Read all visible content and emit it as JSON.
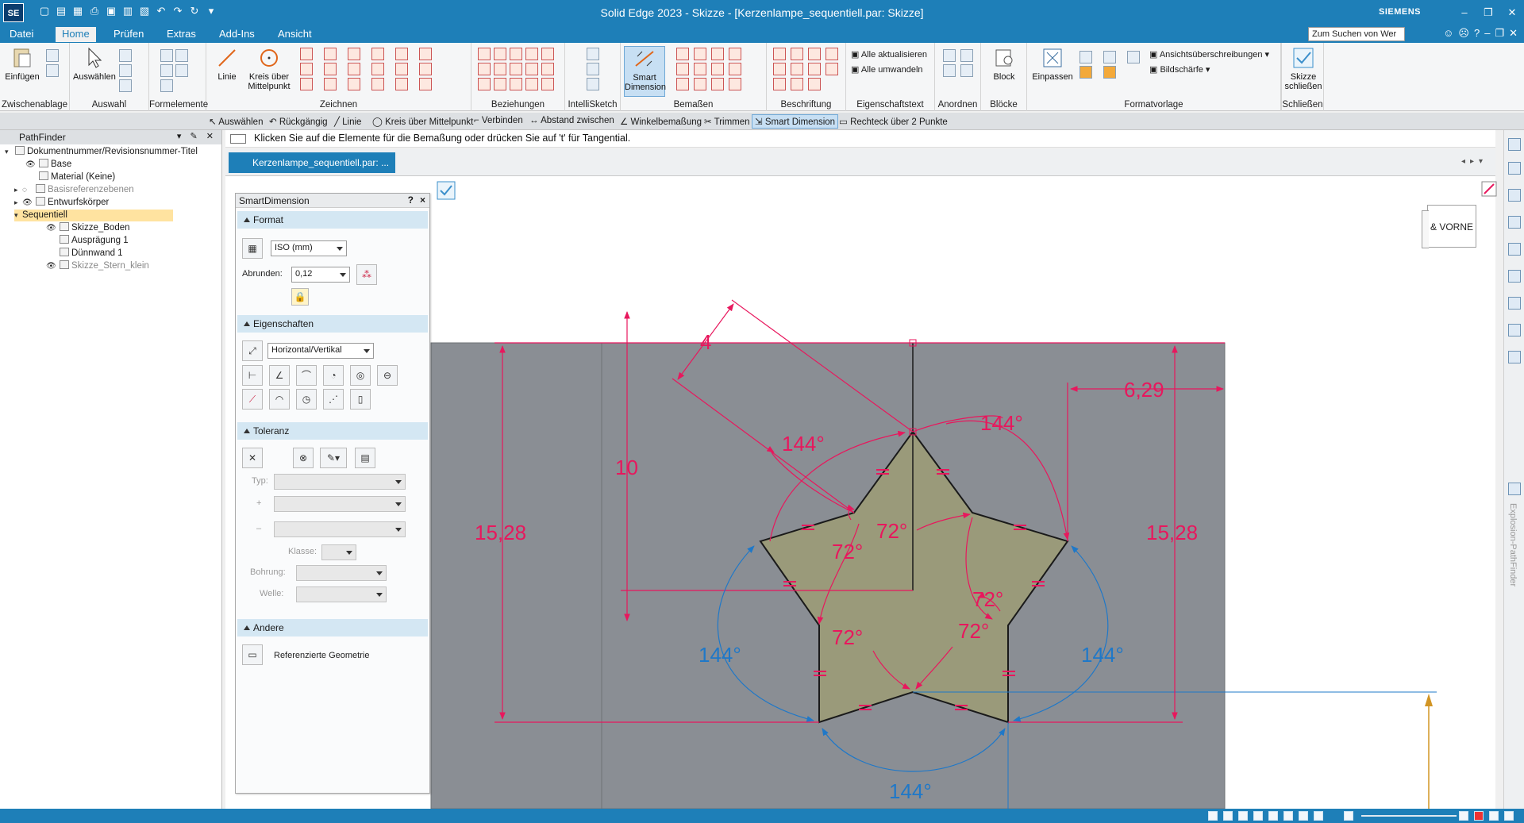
{
  "app": {
    "logo": "SE",
    "window_title": "Solid Edge 2023 - Skizze - [Kerzenlampe_sequentiell.par: Skizze]",
    "brand": "SIEMENS"
  },
  "menu": {
    "items": [
      "Datei",
      "Home",
      "Prüfen",
      "Extras",
      "Add-Ins",
      "Ansicht"
    ],
    "active": "Home",
    "search_placeholder": "Zum Suchen von Wer"
  },
  "ribbon": {
    "groups": [
      "Zwischenablage",
      "Auswahl",
      "Formelemente",
      "Zeichnen",
      "Beziehungen",
      "IntelliSketch",
      "Bemaßen",
      "Beschriftung",
      "Eigenschaftstext",
      "Anordnen",
      "Blöcke",
      "Formatvorlage",
      "Schließen"
    ],
    "buttons": {
      "einfuegen": "Einfügen",
      "auswaehlen": "Auswählen",
      "linie": "Linie",
      "kreis_1": "Kreis über",
      "kreis_2": "Mittelpunkt",
      "smart_1": "Smart",
      "smart_2": "Dimension",
      "alle_aktualisieren": "Alle aktualisieren",
      "alle_umwandeln": "Alle umwandeln",
      "block": "Block",
      "einpassen": "Einpassen",
      "ansicht_ueberschreibungen": "Ansichtsüberschreibungen",
      "bildschaerfe": "Bildschärfe",
      "skizze_1": "Skizze",
      "skizze_2": "schließen"
    }
  },
  "command_bar": [
    "Auswählen",
    "Rückgängig",
    "Linie",
    "Kreis über Mittelpunkt",
    "Verbinden",
    "Abstand zwischen",
    "Winkelbemaßung",
    "Trimmen",
    "Smart Dimension",
    "Rechteck über 2 Punkte"
  ],
  "command_bar_active": "Smart Dimension",
  "pathfinder": {
    "title": "PathFinder",
    "items": [
      {
        "label": "Dokumentnummer/Revisionsnummer-Titel"
      },
      {
        "label": "Base"
      },
      {
        "label": "Material (Keine)"
      },
      {
        "label": "Basisreferenzebenen"
      },
      {
        "label": "Entwurfskörper"
      },
      {
        "label": "Sequentiell"
      },
      {
        "label": "Skizze_Boden"
      },
      {
        "label": "Ausprägung 1"
      },
      {
        "label": "Dünnwand 1"
      },
      {
        "label": "Skizze_Stern_klein"
      }
    ]
  },
  "prompt": "Klicken Sie auf die Elemente für die Bemaßung oder drücken Sie auf 't' für Tangential.",
  "document_tab": "Kerzenlampe_sequentiell.par: ...",
  "smart_dimension_panel": {
    "title": "SmartDimension",
    "help": "?",
    "close": "×",
    "sections": {
      "format": "Format",
      "eigenschaften": "Eigenschaften",
      "toleranz": "Toleranz",
      "andere": "Andere"
    },
    "format_value": "ISO (mm)",
    "abrunden_label": "Abrunden:",
    "abrunden_value": "0,12",
    "orientation_value": "Horizontal/Vertikal",
    "typ_label": "Typ:",
    "plus_label": "+",
    "minus_label": "–",
    "klasse_label": "Klasse:",
    "bohrung_label": "Bohrung:",
    "welle_label": "Welle:",
    "ref_geo_label": "Referenzierte Geometrie"
  },
  "view_cube": {
    "label": "VORNE",
    "prefix": "&"
  },
  "right_rail": {
    "label": "Explosion-PathFinder"
  },
  "dimensions": {
    "d_width": "4",
    "d_height": "10",
    "d_left": "15,28",
    "d_right": "15,28",
    "d_offset": "6,29",
    "a_top_left": "144°",
    "a_top_right": "144°",
    "a_inner_top": "72°",
    "a_inner_left": "72°",
    "a_inner_right": "72°",
    "a_inner_bl": "72°",
    "a_inner_br": "72°",
    "a_left_blue": "144°",
    "a_right_blue": "144°",
    "a_bottom_blue": "144°"
  },
  "colors": {
    "accent": "#1e7fb8",
    "dimension": "#e8175d",
    "driven_dimension": "#1f78c8",
    "sketch_fill": "#9a9a7a",
    "plane": "#8a8e94"
  }
}
